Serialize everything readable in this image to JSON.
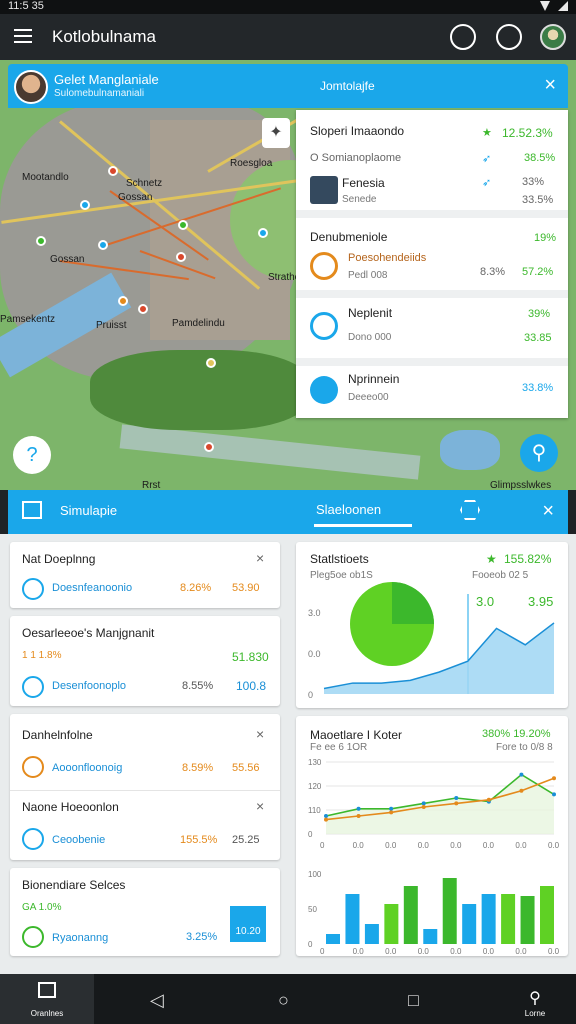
{
  "status": {
    "time": "11:5 35"
  },
  "app": {
    "title": "Kotlobulnama"
  },
  "map_header": {
    "name": "Gelet Manglaniale",
    "subtitle": "Sulomebulnamaniali",
    "center_label": "Jomtolajfe"
  },
  "map_labels": [
    "Mootandlo",
    "Gossan",
    "Schnetz",
    "Roesgloa",
    "Pamsekentz",
    "Gossan",
    "Stratheloo",
    "Pamdelindu",
    "Pruisst",
    "Glimpsslwkes",
    "Rrst"
  ],
  "side_panel": {
    "header": {
      "title": "Sloperi Imaaondo",
      "value": "12.52.3%",
      "sub": "O Somianoplaome",
      "sub_value": "38.5%"
    },
    "row1": {
      "title": "Fenesia",
      "sub": "Senede",
      "v1": "33%",
      "v2": "33.5%"
    },
    "row2": {
      "title": "Denubmeniole",
      "value": "19%",
      "item_title": "Poesohendeiids",
      "item_sub": "Pedl 008",
      "v1": "8.3%",
      "v2": "57.2%"
    },
    "row3": {
      "title": "Neplenit",
      "sub": "Dono 000",
      "v1": "39%",
      "v2": "33.85"
    },
    "row4": {
      "title": "Nprinnein",
      "sub": "Deeeo00",
      "v1": "33.8%"
    }
  },
  "section_bar": {
    "left_label": "Simulapie",
    "tab_label": "Slaeloonen"
  },
  "cards": {
    "c1": {
      "title": "Nat Doeplnng",
      "link": "Doesnfeanoonio",
      "v1": "8.26%",
      "v2": "53.90"
    },
    "c2": {
      "title": "Oesarleeoe's Manjgnanit",
      "sub": "1 1 1.8%",
      "v_top": "51.830",
      "link": "Desenfoonoplo",
      "v1": "8.55%",
      "v2": "100.8"
    },
    "c3": {
      "title": "Danhelnfolne",
      "link": "Aooonfloonoig",
      "v1": "8.59%",
      "v2": "55.56"
    },
    "c4": {
      "title": "Naone Hoeoonlon",
      "link": "Ceoobenie",
      "v1": "155.5%",
      "v2": "25.25"
    },
    "c5": {
      "title": "Bionendiare Selces",
      "sub": "GA 1.0%",
      "link": "Ryaonanng",
      "v1": "3.25%",
      "bar_label": "10.20"
    },
    "stats": {
      "title": "Statlstioets",
      "value": "155.82%",
      "sub_left": "Pleg5oe ob1S",
      "sub_right": "Fooeob 02 5",
      "v1": "3.0",
      "v2": "3.95",
      "y_ticks": [
        "3.0",
        "0.0",
        "0"
      ]
    },
    "chart2": {
      "title": "Maoetlare I Koter",
      "v1": "380% 19.20%",
      "sub_left": "Fe ee 6 1OR",
      "sub_right": "Fore to 0/8 8"
    }
  },
  "chart_data": [
    {
      "type": "area",
      "title": "Statlstioets",
      "x": [
        0,
        1,
        2,
        3,
        4,
        5,
        6,
        7,
        8
      ],
      "series": [
        {
          "values": [
            2,
            4,
            4,
            5,
            8,
            12,
            24,
            18,
            26
          ]
        }
      ],
      "ylim": [
        0,
        30
      ]
    },
    {
      "type": "line",
      "title": "Maoetlare I Koter",
      "x": [
        "0",
        "0.0",
        "0.0",
        "0.0",
        "0.0",
        "0.0",
        "0.0",
        "0.0"
      ],
      "series": [
        {
          "values": [
            10,
            14,
            14,
            17,
            20,
            18,
            33,
            22
          ]
        },
        {
          "values": [
            8,
            10,
            12,
            15,
            17,
            19,
            24,
            31
          ]
        }
      ],
      "ylim": [
        0,
        40
      ]
    },
    {
      "type": "bar",
      "x": [
        "0",
        "0.0",
        "0.0",
        "0.0",
        "0.0",
        "0.0",
        "0.0",
        "0.0"
      ],
      "series": [
        {
          "values": [
            10,
            50,
            20,
            40,
            58,
            15,
            66,
            40,
            50,
            50,
            48,
            58
          ]
        }
      ],
      "ylim": [
        0,
        70
      ]
    }
  ],
  "navbar": {
    "home_label": "Oranlnes",
    "search_label": "Lorne"
  },
  "colors": {
    "accent": "#1aa7ea",
    "green": "#3cb82c",
    "orange": "#e48a1c",
    "map_green": "#7db56a"
  }
}
